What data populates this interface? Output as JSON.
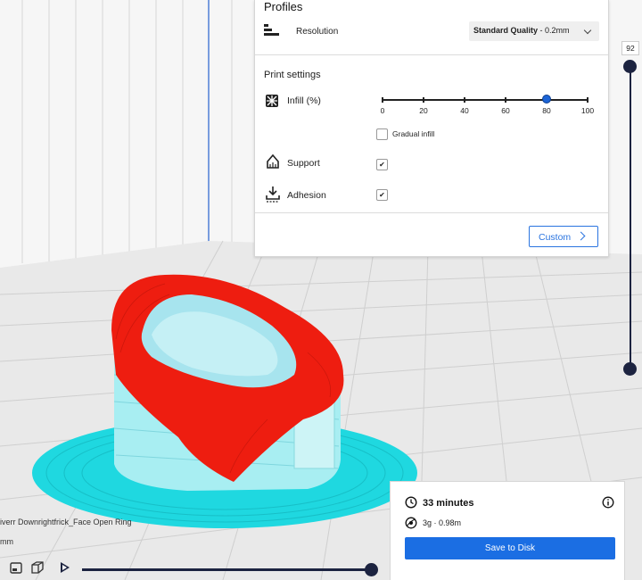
{
  "profiles": {
    "title": "Profiles",
    "resolution_label": "Resolution",
    "resolution_value_bold": "Standard Quality",
    "resolution_value_rest": " - 0.2mm"
  },
  "print_settings": {
    "title": "Print settings",
    "infill_label": "Infill (%)",
    "infill_value": 80,
    "infill_ticks": [
      "0",
      "20",
      "40",
      "60",
      "80",
      "100"
    ],
    "gradual_infill_label": "Gradual infill",
    "gradual_infill_checked": false,
    "support_label": "Support",
    "support_checked": true,
    "adhesion_label": "Adhesion",
    "adhesion_checked": true,
    "custom_label": "Custom"
  },
  "estimate": {
    "time": "33 minutes",
    "material": "3g · 0.98m",
    "save_label": "Save to Disk"
  },
  "layer_view": {
    "current_layer": "92",
    "object_name": "iverr Downrightfrick_Face Open Ring",
    "object_dims": "mm"
  },
  "icons": {
    "resolution": "resolution-icon",
    "infill": "infill-icon",
    "support": "support-icon",
    "adhesion": "adhesion-icon",
    "clock": "clock-icon",
    "spool": "spool-icon",
    "info": "info-icon",
    "play": "play-icon"
  },
  "colors": {
    "accent": "#1b6ee3",
    "slider_dark": "#1c2340",
    "model_top": "#ee1d10",
    "model_support": "#a8eef2",
    "brim": "#1fd8e0"
  }
}
